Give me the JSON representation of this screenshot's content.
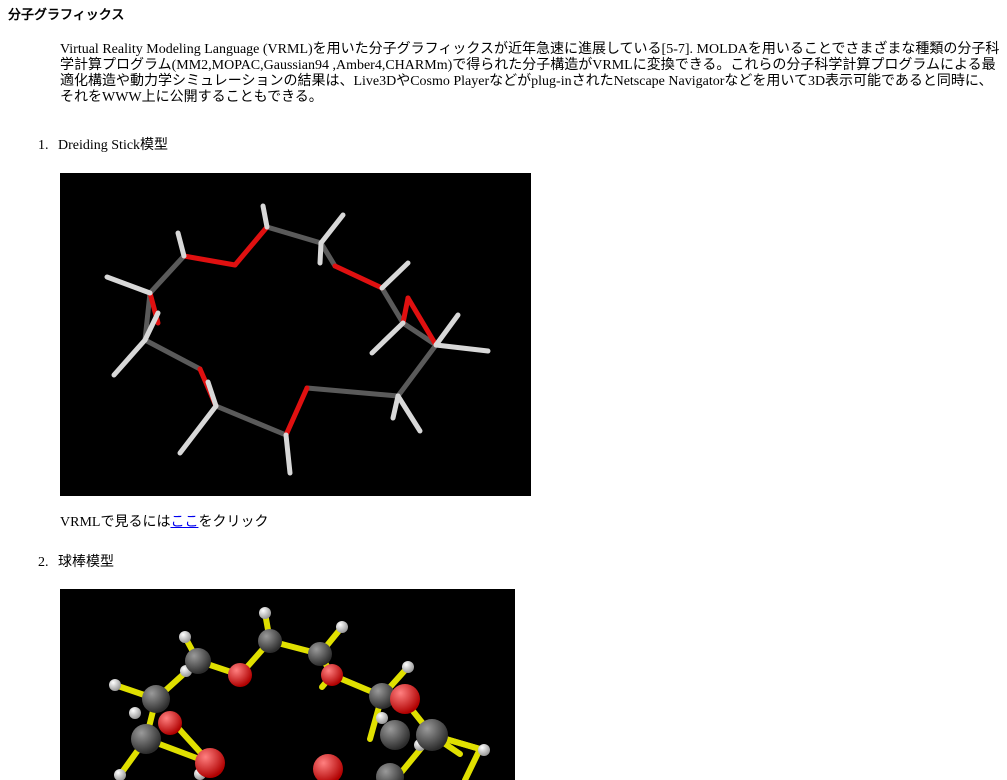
{
  "page": {
    "title": "分子グラフィックス",
    "intro": "Virtual Reality Modeling Language (VRML)を用いた分子グラフィックスが近年急速に進展している[5-7]. MOLDAを用いることでさまざまな種類の分子科学計算プログラム(MM2,MOPAC,Gaussian94 ,Amber4,CHARMm)で得られた分子構造がVRMLに変換できる。これらの分子科学計算プログラムによる最適化構造や動力学シミュレーションの結果は、Live3DやCosmo Playerなどがplug-inされたNetscape Navigatorなどを用いて3D表示可能であると同時に、それをWWW上に公開することもできる。"
  },
  "items": [
    {
      "number": "1.",
      "label": "Dreiding Stick模型",
      "figure_desc": "stick-model",
      "caption_before": "VRMLで見るには",
      "caption_link": "ここ",
      "caption_after": "をクリック"
    },
    {
      "number": "2.",
      "label": "球棒模型",
      "figure_desc": "ball-and-stick-model"
    }
  ],
  "colors": {
    "link": "#0000ee",
    "carbon": "#555555",
    "oxygen": "#ff1a1a",
    "hydrogen": "#e6e6e6",
    "bond_yellow": "#e8e800",
    "background": "#000000"
  }
}
